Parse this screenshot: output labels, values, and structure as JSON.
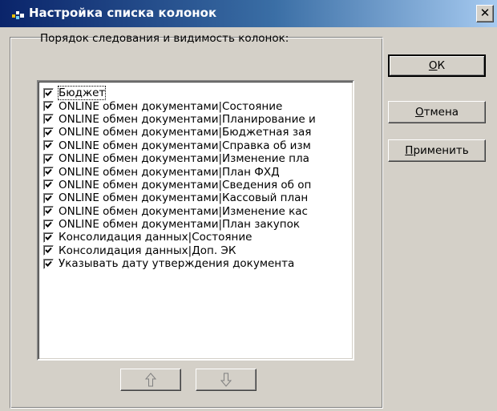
{
  "window": {
    "title": "Настройка списка колонок",
    "icon": "app-icon",
    "close_label": "✕"
  },
  "group": {
    "label": "Порядок следования и видимость колонок:"
  },
  "columns": [
    {
      "label": "Бюджет",
      "checked": true,
      "focused": true
    },
    {
      "label": "ONLINE обмен документами|Состояние",
      "checked": true
    },
    {
      "label": "ONLINE обмен документами|Планирование и",
      "checked": true
    },
    {
      "label": "ONLINE обмен документами|Бюджетная зая",
      "checked": true
    },
    {
      "label": "ONLINE обмен документами|Справка об изм",
      "checked": true
    },
    {
      "label": "ONLINE обмен документами|Изменение пла",
      "checked": true
    },
    {
      "label": "ONLINE обмен документами|План ФХД",
      "checked": true
    },
    {
      "label": "ONLINE обмен документами|Сведения об оп",
      "checked": true
    },
    {
      "label": "ONLINE обмен документами|Кассовый план",
      "checked": true
    },
    {
      "label": "ONLINE обмен документами|Изменение кас",
      "checked": true
    },
    {
      "label": "ONLINE обмен документами|План закупок",
      "checked": true
    },
    {
      "label": "Консолидация данных|Состояние",
      "checked": true
    },
    {
      "label": "Консолидация данных|Доп. ЭК",
      "checked": true
    },
    {
      "label": "Указывать дату утверждения документа",
      "checked": true
    }
  ],
  "buttons": {
    "ok": {
      "accel": "О",
      "rest": "К"
    },
    "cancel": {
      "accel": "О",
      "rest": "тмена"
    },
    "apply": {
      "accel": "П",
      "rest": "рименить"
    }
  },
  "move": {
    "up_icon": "arrow-up-icon",
    "down_icon": "arrow-down-icon"
  }
}
